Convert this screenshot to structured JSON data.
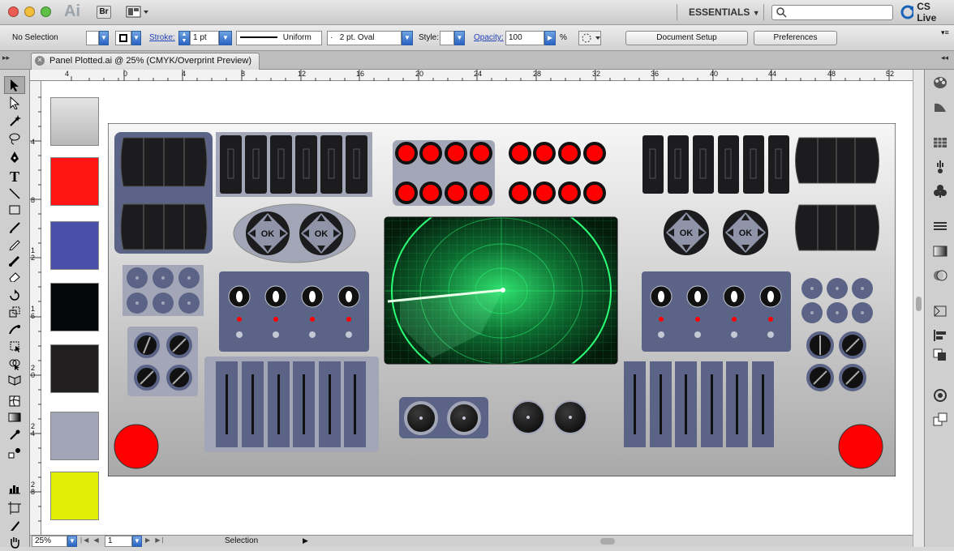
{
  "titlebar": {
    "app_logo": "Ai",
    "bridge_label": "Br",
    "workspace": "ESSENTIALS",
    "search_placeholder": "",
    "cs_live": "CS Live"
  },
  "control_bar": {
    "selection_status": "No Selection",
    "stroke_label": "Stroke:",
    "stroke_weight": "1 pt",
    "stroke_profile": "Uniform",
    "brush": "2 pt. Oval",
    "brush_prefix": "·",
    "style_label": "Style:",
    "opacity_label": "Opacity:",
    "opacity_value": "100",
    "opacity_unit": "%",
    "document_setup": "Document Setup",
    "preferences": "Preferences"
  },
  "document": {
    "tab_title": "Panel Plotted.ai @ 25% (CMYK/Overprint Preview)",
    "close_glyph": "×"
  },
  "rulers": {
    "top": [
      "4",
      "0",
      "4",
      "8",
      "12",
      "16",
      "20",
      "24",
      "28",
      "32",
      "36",
      "40",
      "44",
      "48",
      "52"
    ],
    "left": [
      "4",
      "8",
      "1 2",
      "1 6",
      "2 0",
      "2 4",
      "2 8"
    ]
  },
  "status": {
    "zoom": "25%",
    "page": "1",
    "tool": "Selection"
  },
  "ok_label": "OK",
  "colors": {
    "red": "#ff0000",
    "blue_gray": "#5b6487",
    "dark": "#1c1c1e",
    "panel_gray": "#a3a6b6",
    "accent_blue": "#2a64c4",
    "radar_green": "#1ec85a"
  },
  "swatches": [
    "#dcdcdc",
    "#ff1414",
    "#4a4fa8",
    "#050808",
    "#221f20",
    "#a2a5b5",
    "#e3ee08"
  ],
  "icons": {
    "tools": [
      "selection-tool-icon",
      "direct-selection-tool-icon",
      "magic-wand-icon",
      "lasso-icon",
      "pen-icon",
      "type-icon",
      "line-icon",
      "rectangle-icon",
      "paintbrush-icon",
      "pencil-icon",
      "blob-brush-icon",
      "eraser-icon",
      "rotate-icon",
      "scale-icon",
      "warp-icon",
      "free-transform-icon",
      "shape-builder-icon",
      "perspective-grid-icon",
      "mesh-icon",
      "gradient-icon",
      "eyedropper-icon",
      "blend-icon",
      "graph-icon",
      "artboard-icon",
      "slice-icon",
      "hand-icon"
    ],
    "panels": [
      "color-icon",
      "color-guide-icon",
      "swatches-icon",
      "brushes-icon",
      "symbols-icon",
      "stroke-icon",
      "gradient-panel-icon",
      "transparency-icon",
      "appearance-icon",
      "align-icon",
      "pathfinder-icon",
      "layers-icon",
      "artboards-icon"
    ]
  }
}
